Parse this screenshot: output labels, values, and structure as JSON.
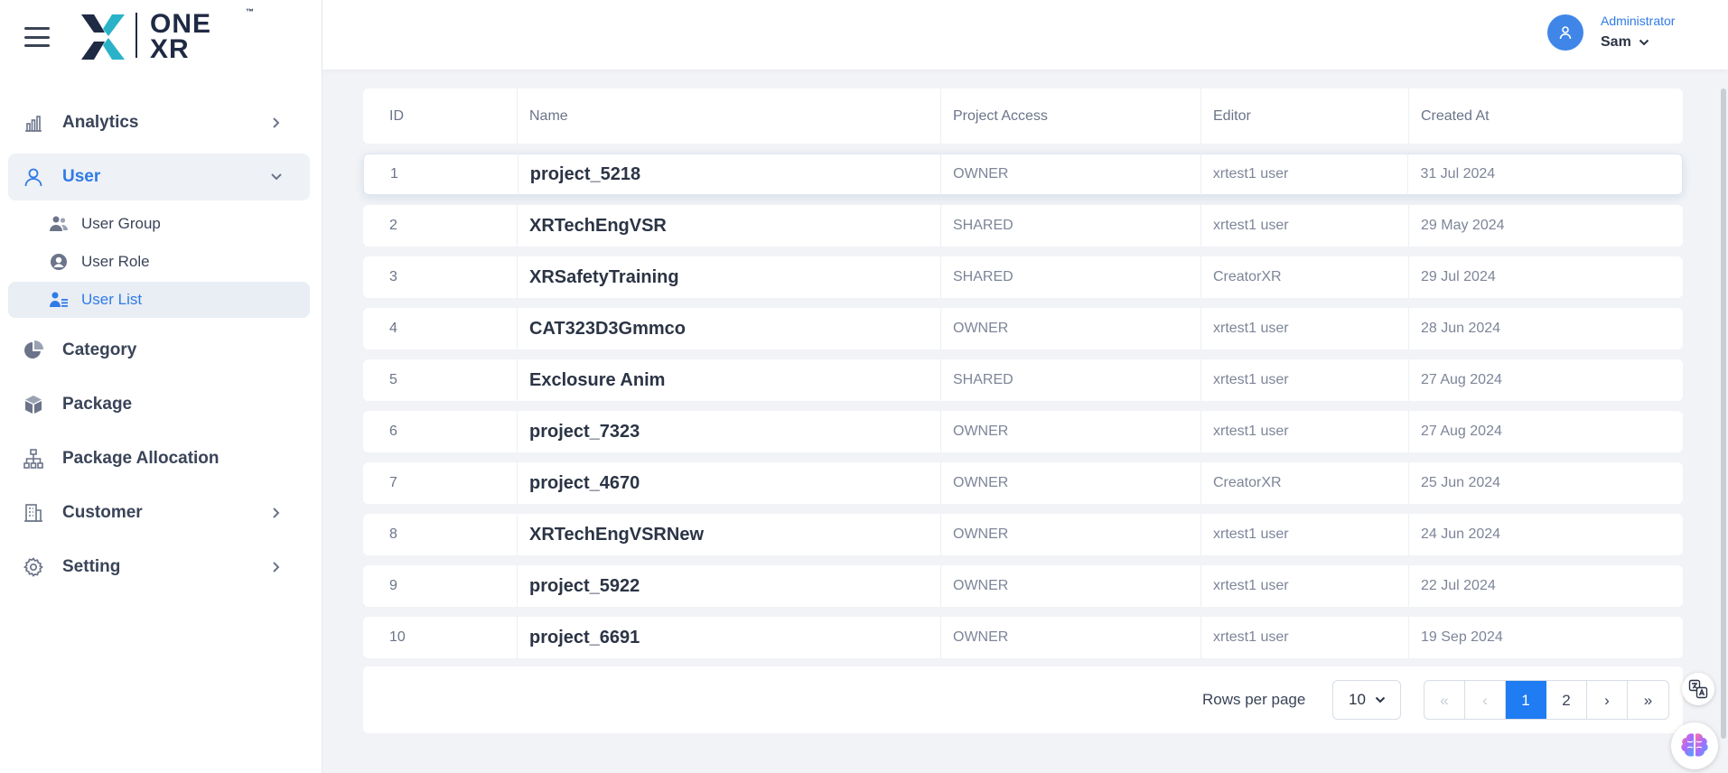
{
  "brand": {
    "logo_top": "ONE",
    "logo_bottom": "XR",
    "logo_tm": "™"
  },
  "header": {
    "role": "Administrator",
    "user_name": "Sam"
  },
  "sidebar": {
    "items": [
      {
        "label": "Analytics",
        "icon": "bar-chart-icon",
        "chevron": "right"
      },
      {
        "label": "User",
        "icon": "user-icon",
        "chevron": "down",
        "active": true
      },
      {
        "label": "Category",
        "icon": "pie-chart-icon"
      },
      {
        "label": "Package",
        "icon": "box-icon"
      },
      {
        "label": "Package Allocation",
        "icon": "sitemap-icon"
      },
      {
        "label": "Customer",
        "icon": "building-icon",
        "chevron": "right"
      },
      {
        "label": "Setting",
        "icon": "gear-icon",
        "chevron": "right"
      }
    ],
    "user_sub": [
      {
        "label": "User Group",
        "icon": "users-icon"
      },
      {
        "label": "User Role",
        "icon": "user-circle-icon"
      },
      {
        "label": "User List",
        "icon": "user-list-icon",
        "active": true
      }
    ]
  },
  "table": {
    "headers": [
      "ID",
      "Name",
      "Project Access",
      "Editor",
      "Created At"
    ],
    "rows": [
      {
        "id": "1",
        "name": "project_5218",
        "access": "OWNER",
        "editor": "xrtest1 user",
        "created": "31 Jul 2024"
      },
      {
        "id": "2",
        "name": "XRTechEngVSR",
        "access": "SHARED",
        "editor": "xrtest1 user",
        "created": "29 May 2024"
      },
      {
        "id": "3",
        "name": "XRSafetyTraining",
        "access": "SHARED",
        "editor": "CreatorXR",
        "created": "29 Jul 2024"
      },
      {
        "id": "4",
        "name": "CAT323D3Gmmco",
        "access": "OWNER",
        "editor": "xrtest1 user",
        "created": "28 Jun 2024"
      },
      {
        "id": "5",
        "name": "Exclosure Anim",
        "access": "SHARED",
        "editor": "xrtest1 user",
        "created": "27 Aug 2024"
      },
      {
        "id": "6",
        "name": "project_7323",
        "access": "OWNER",
        "editor": "xrtest1 user",
        "created": "27 Aug 2024"
      },
      {
        "id": "7",
        "name": "project_4670",
        "access": "OWNER",
        "editor": "CreatorXR",
        "created": "25 Jun 2024"
      },
      {
        "id": "8",
        "name": "XRTechEngVSRNew",
        "access": "OWNER",
        "editor": "xrtest1 user",
        "created": "24 Jun 2024"
      },
      {
        "id": "9",
        "name": "project_5922",
        "access": "OWNER",
        "editor": "xrtest1 user",
        "created": "22 Jul 2024"
      },
      {
        "id": "10",
        "name": "project_6691",
        "access": "OWNER",
        "editor": "xrtest1 user",
        "created": "19 Sep 2024"
      }
    ]
  },
  "pagination": {
    "rows_per_page_label": "Rows per page",
    "rows_per_page_value": "10",
    "first": "«",
    "prev": "‹",
    "pages": [
      "1",
      "2"
    ],
    "next": "›",
    "last": "»",
    "current_page": "1"
  },
  "colors": {
    "accent": "#1f7cf2",
    "sidebar_active_text": "#2f7be6",
    "background": "#f1f3f6"
  }
}
